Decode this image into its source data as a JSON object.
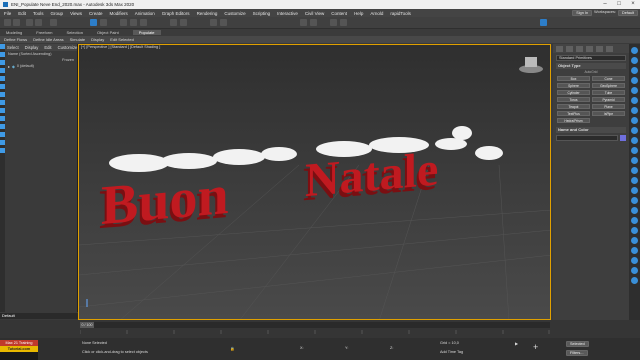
{
  "titlebar": {
    "title": "ENI_Populate Neve End_2020.max - Autodesk 3ds Max 2020"
  },
  "menu": {
    "items": [
      "File",
      "Edit",
      "Tools",
      "Group",
      "Views",
      "Create",
      "Modifiers",
      "Animation",
      "Graph Editors",
      "Rendering",
      "Customize",
      "Scripting",
      "Interactive",
      "Civil View",
      "Content",
      "Help",
      "Arnold",
      "rapidTools"
    ],
    "signin": "Sign In",
    "workspaces": "Workspaces:",
    "workspace_value": "Default"
  },
  "ribbon": {
    "tabs": [
      "Modeling",
      "Freeform",
      "Selection",
      "Object Paint",
      "Populate"
    ],
    "active": "Populate",
    "items": [
      "Define Flows",
      "Define Idle Areas",
      "Simulate",
      "Display",
      "Edit Selected"
    ]
  },
  "scene": {
    "tabs": [
      "Select",
      "Display",
      "Edit",
      "Customize"
    ],
    "sort_label": "Name (Sorted Ascending)",
    "frozen_label": "Frozen",
    "root": "0 (default)"
  },
  "viewport": {
    "label": "[+] [Perspective ] [Standard ] [Default Shading ]",
    "text3d": "Buon Natale"
  },
  "command": {
    "dropdown": "Standard Primitives",
    "object_type": "Object Type",
    "autogrid": "AutoGrid",
    "buttons": [
      "Box",
      "Cone",
      "Sphere",
      "GeoSphere",
      "Cylinder",
      "Tube",
      "Torus",
      "Pyramid",
      "Teapot",
      "Plane",
      "TextPlus",
      "IsPipe",
      "Hedra/Prism"
    ],
    "name_color": "Name and Color"
  },
  "timeline": {
    "frame": "0 / 100",
    "layer": "Default"
  },
  "status": {
    "none_selected": "None Selected",
    "prompt": "Click or click-and-drag to select objects",
    "x": "X:",
    "y": "Y:",
    "z": "Z:",
    "grid": "Grid = 10,0",
    "addtimetag": "Add Time Tag",
    "selected": "Selected",
    "filters": "Filters..."
  },
  "promo": {
    "line1": "Max 21 Training",
    "line2": "Tutorial.com"
  },
  "colors": {
    "text_red": "#b3171c",
    "snow": "#f2f2f2",
    "accent_blue": "#2d7ec9",
    "viewport_border": "#e0a000"
  }
}
